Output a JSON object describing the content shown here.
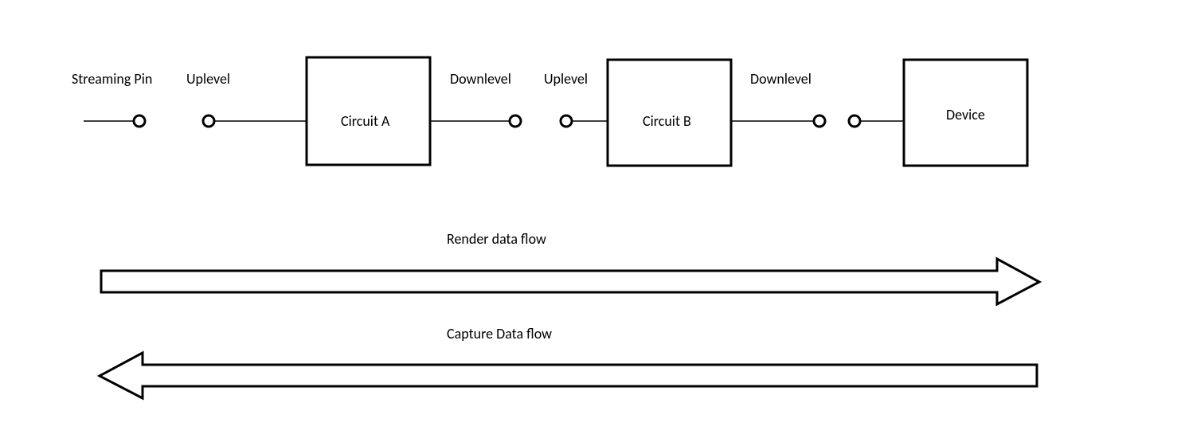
{
  "labels": {
    "streamingPin": "Streaming Pin",
    "uplevel1": "Uplevel",
    "circuitA": "Circuit A",
    "downlevel1": "Downlevel",
    "uplevel2": "Uplevel",
    "circuitB": "Circuit B",
    "downlevel2": "Downlevel",
    "device": "Device",
    "renderFlow": "Render data flow",
    "captureFlow": "Capture Data flow"
  }
}
